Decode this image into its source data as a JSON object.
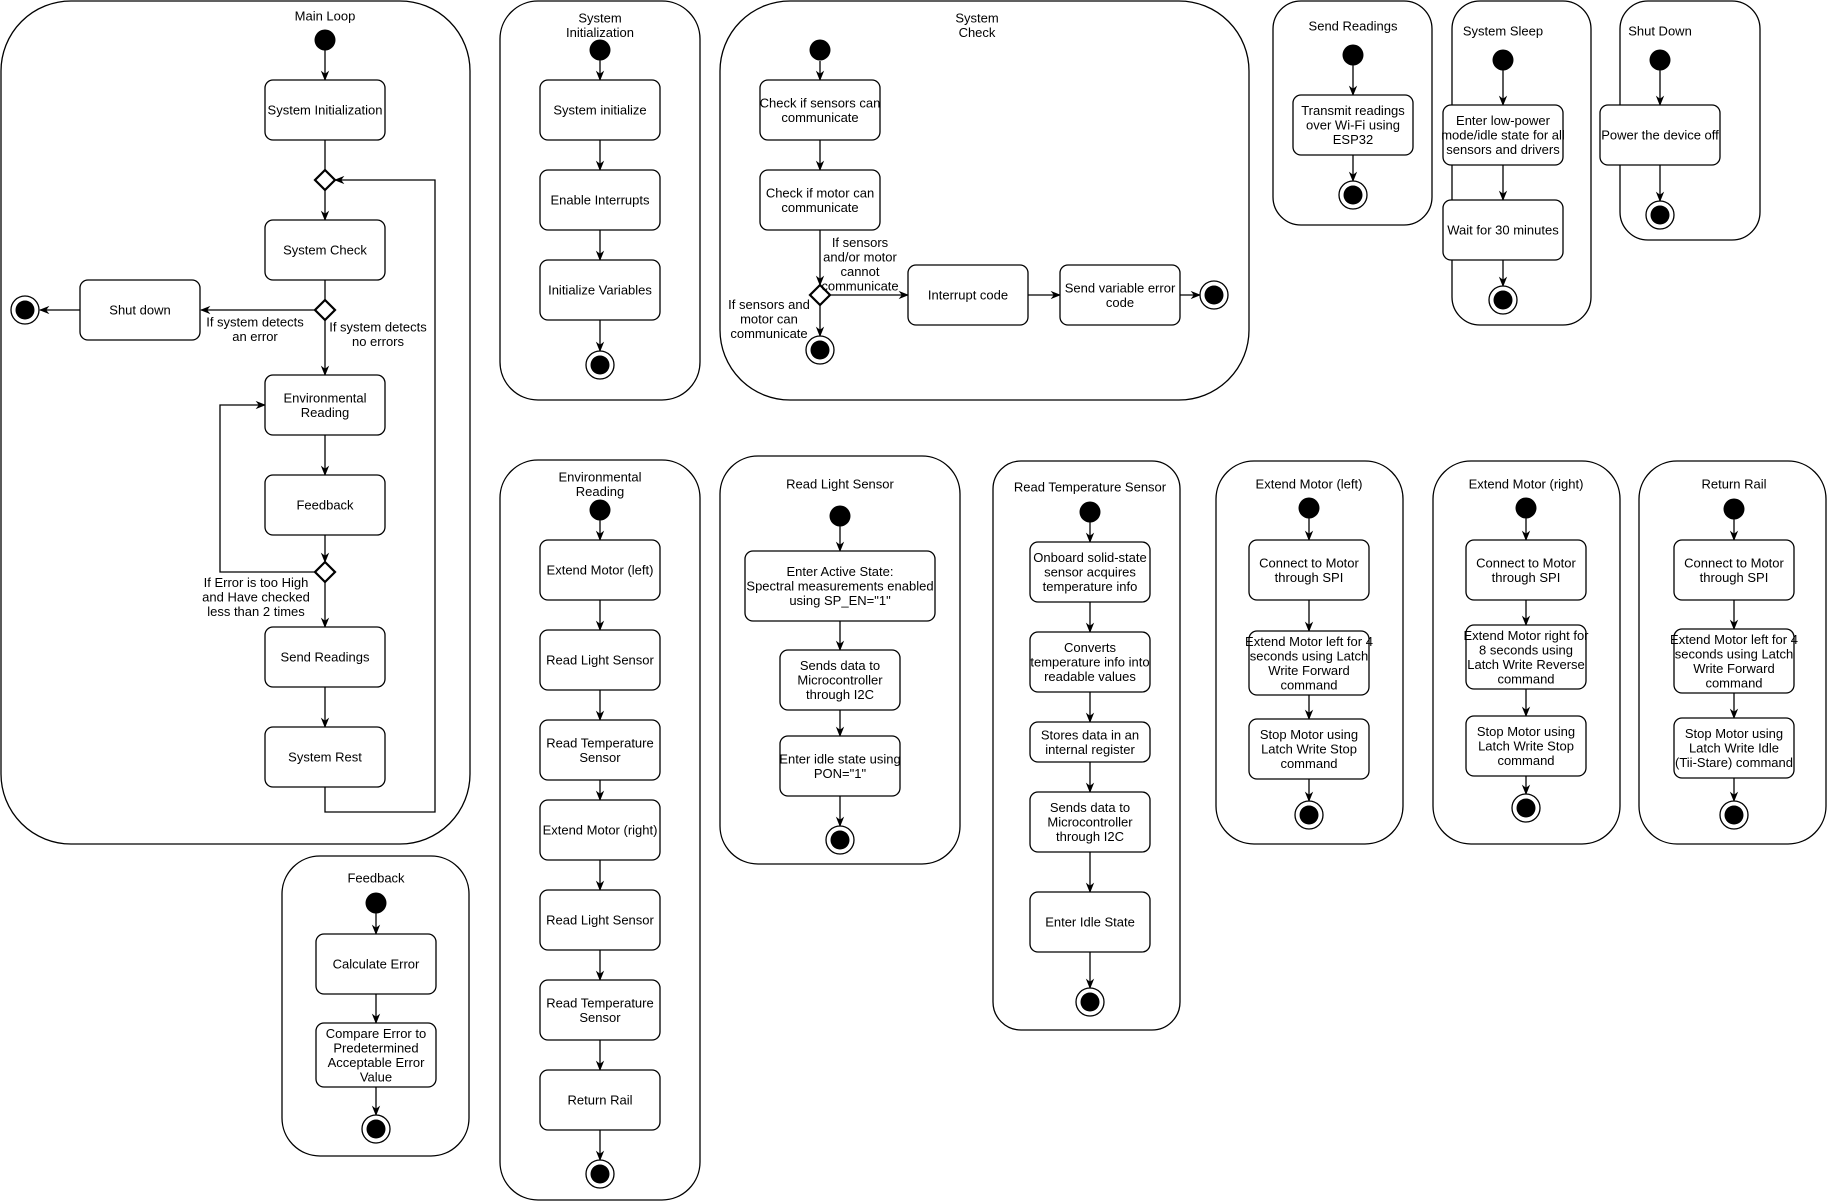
{
  "diagram": {
    "type": "UML activity diagrams",
    "colors": {
      "stroke": "#000000",
      "fill": "#ffffff",
      "text": "#000000"
    },
    "panels": {
      "main_loop": {
        "title": "Main Loop",
        "nodes": {
          "sys_init": "System Initialization",
          "sys_check": "System Check",
          "shut_down": "Shut down",
          "env_reading": [
            "Environmental",
            "Reading"
          ],
          "feedback": "Feedback",
          "send_readings": "Send Readings",
          "system_rest": "System Rest"
        },
        "guards": {
          "error": [
            "If system detects",
            "an error"
          ],
          "no_error": [
            "If system detects",
            "no errors"
          ],
          "retry": [
            "If Error is too High",
            "and Have checked",
            "less than 2 times"
          ]
        }
      },
      "system_initialization": {
        "title": [
          "System",
          "Initialization"
        ],
        "nodes": [
          "System initialize",
          "Enable Interrupts",
          "Initialize Variables"
        ]
      },
      "system_check": {
        "title": [
          "System",
          "Check"
        ],
        "nodes": {
          "check_sensors": [
            "Check if sensors can",
            "communicate"
          ],
          "check_motor": [
            "Check if motor can",
            "communicate"
          ],
          "interrupt": "Interrupt code",
          "send_error": [
            "Send variable error",
            "code"
          ]
        },
        "guards": {
          "fail": [
            "If sensors",
            "and/or motor",
            "cannot",
            "communicate"
          ],
          "ok": [
            "If sensors and",
            "motor can",
            "communicate"
          ]
        }
      },
      "send_readings": {
        "title": "Send Readings",
        "nodes": [
          [
            "Transmit readings",
            "over Wi-Fi using",
            "ESP32"
          ]
        ]
      },
      "system_sleep": {
        "title": "System Sleep",
        "nodes": [
          [
            "Enter low-power",
            "mode/idle state for all",
            "sensors and drivers"
          ],
          [
            "Wait for 30 minutes"
          ]
        ]
      },
      "shut_down": {
        "title": "Shut Down",
        "nodes": [
          [
            "Power the device off"
          ]
        ]
      },
      "feedback": {
        "title": "Feedback",
        "nodes": [
          [
            "Calculate Error"
          ],
          [
            "Compare Error to",
            "Predetermined",
            "Acceptable Error",
            "Value"
          ]
        ]
      },
      "environmental_reading": {
        "title": [
          "Environmental",
          "Reading"
        ],
        "nodes": [
          [
            "Extend Motor (left)"
          ],
          [
            "Read Light Sensor"
          ],
          [
            "Read Temperature",
            "Sensor"
          ],
          [
            "Extend Motor (right)"
          ],
          [
            "Read Light Sensor"
          ],
          [
            "Read Temperature",
            "Sensor"
          ],
          [
            "Return Rail"
          ]
        ]
      },
      "read_light_sensor": {
        "title": "Read Light Sensor",
        "nodes": [
          [
            "Enter Active State:",
            "Spectral measurements enabled",
            "using SP_EN=\"1\""
          ],
          [
            "Sends data to",
            "Microcontroller",
            "through I2C"
          ],
          [
            "Enter idle state using",
            "PON=\"1\""
          ]
        ]
      },
      "read_temperature_sensor": {
        "title": "Read Temperature Sensor",
        "nodes": [
          [
            "Onboard solid-state",
            "sensor acquires",
            "temperature info"
          ],
          [
            "Converts",
            "temperature info into",
            "readable values"
          ],
          [
            "Stores data in an",
            "internal register"
          ],
          [
            "Sends data to",
            "Microcontroller",
            "through I2C"
          ],
          [
            "Enter Idle State"
          ]
        ]
      },
      "extend_motor_left": {
        "title": "Extend Motor (left)",
        "nodes": [
          [
            "Connect to Motor",
            "through SPI"
          ],
          [
            "Extend Motor left for 4",
            "seconds using Latch",
            "Write Forward",
            "command"
          ],
          [
            "Stop Motor using",
            "Latch Write Stop",
            "command"
          ]
        ]
      },
      "extend_motor_right": {
        "title": "Extend Motor (right)",
        "nodes": [
          [
            "Connect to Motor",
            "through SPI"
          ],
          [
            "Extend Motor right for",
            "8 seconds using",
            "Latch Write Reverse",
            "command"
          ],
          [
            "Stop Motor using",
            "Latch Write Stop",
            "command"
          ]
        ]
      },
      "return_rail": {
        "title": "Return Rail",
        "nodes": [
          [
            "Connect to Motor",
            "through SPI"
          ],
          [
            "Extend Motor left for 4",
            "seconds using Latch",
            "Write Forward",
            "command"
          ],
          [
            "Stop Motor using",
            "Latch Write Idle",
            "(Tii-Stare) command"
          ]
        ]
      }
    }
  }
}
